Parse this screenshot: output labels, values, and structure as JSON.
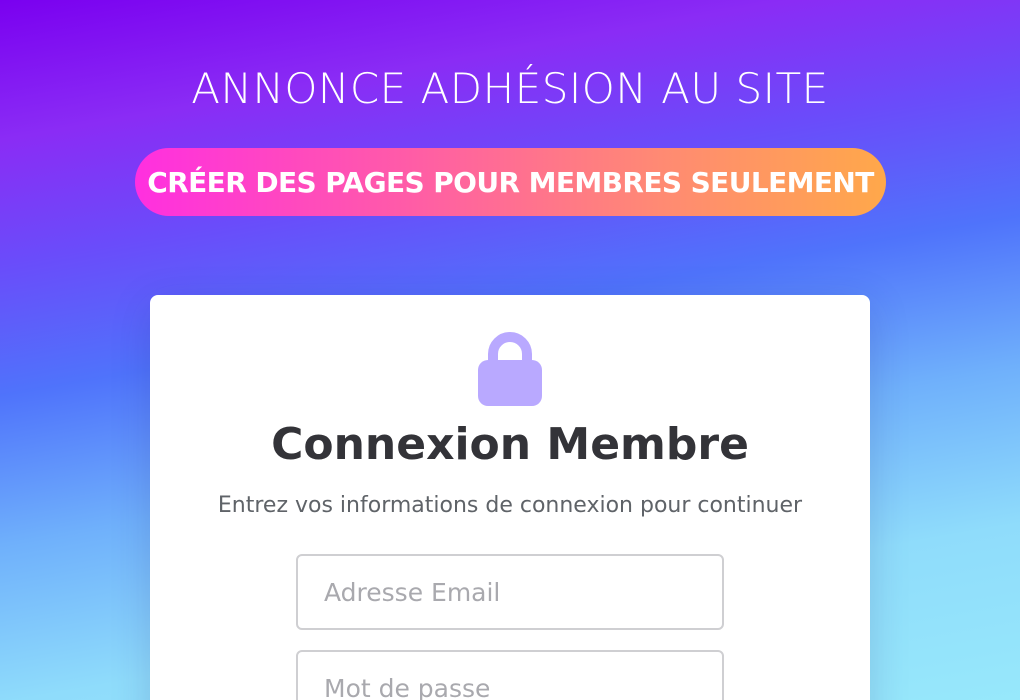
{
  "header": {
    "headline": "ANNONCE ADHÉSION AU SITE",
    "cta_label": "CRÉER DES PAGES POUR MEMBRES SEULEMENT"
  },
  "login_card": {
    "icon": "lock-icon",
    "title": "Connexion Membre",
    "subtitle": "Entrez vos informations de connexion pour continuer",
    "email_placeholder": "Adresse Email",
    "password_placeholder": "Mot de passe"
  },
  "colors": {
    "background_top": "#7a00f0",
    "background_mid": "#4f73fb",
    "background_bottom": "#97e8fb",
    "pill_start": "#ff2fe0",
    "pill_end": "#ffa84a",
    "lock": "#b9a9ff",
    "title_text": "#333338"
  }
}
